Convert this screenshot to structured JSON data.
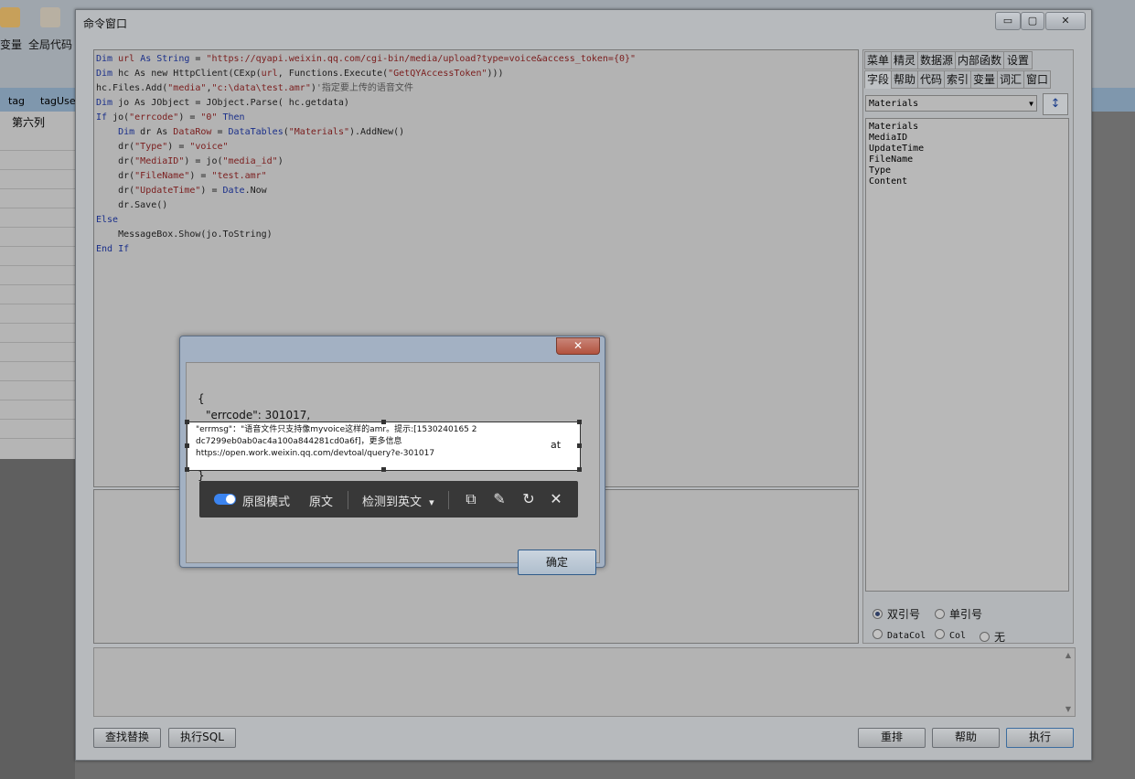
{
  "background": {
    "toolbar_labels": [
      "变量",
      "全局代码"
    ],
    "col_headers": [
      "tag",
      "tagUse"
    ],
    "column_label": "第六列"
  },
  "window": {
    "title": "命令窗口",
    "min_glyph": "▭",
    "max_glyph": "▢",
    "close_glyph": "✕"
  },
  "editor": {
    "code_lines": [
      [
        {
          "t": "Dim ",
          "c": "kw"
        },
        {
          "t": "url ",
          "c": "str"
        },
        {
          "t": "As String",
          "c": "kw"
        },
        {
          "t": " = ",
          "c": ""
        },
        {
          "t": "\"https://qyapi.weixin.qq.com/cgi-bin/media/upload?type=voice&access_token={0}\"",
          "c": "str"
        }
      ],
      [
        {
          "t": "Dim ",
          "c": "kw"
        },
        {
          "t": "hc As new HttpClient(CExp(",
          "c": ""
        },
        {
          "t": "url",
          "c": "str"
        },
        {
          "t": ", Functions.Execute(",
          "c": ""
        },
        {
          "t": "\"GetQYAccessToken\"",
          "c": "str"
        },
        {
          "t": ")))",
          "c": ""
        }
      ],
      [
        {
          "t": "hc.Files.Add(",
          "c": ""
        },
        {
          "t": "\"media\"",
          "c": "str"
        },
        {
          "t": ",",
          "c": ""
        },
        {
          "t": "\"c:\\data\\test.amr\"",
          "c": "str"
        },
        {
          "t": ")",
          "c": ""
        },
        {
          "t": "'指定要上传的语音文件",
          "c": "cm"
        }
      ],
      [
        {
          "t": "Dim ",
          "c": "kw"
        },
        {
          "t": "jo As JObject = JObject.Parse( hc.getdata)",
          "c": ""
        }
      ],
      [
        {
          "t": "If ",
          "c": "kw"
        },
        {
          "t": "jo(",
          "c": ""
        },
        {
          "t": "\"errcode\"",
          "c": "str"
        },
        {
          "t": ") = ",
          "c": ""
        },
        {
          "t": "\"0\"",
          "c": "str"
        },
        {
          "t": " Then",
          "c": "kw"
        }
      ],
      [
        {
          "t": "    Dim ",
          "c": "kw"
        },
        {
          "t": "dr As ",
          "c": ""
        },
        {
          "t": "DataRow",
          "c": "str"
        },
        {
          "t": " = ",
          "c": ""
        },
        {
          "t": "DataTables",
          "c": "kw"
        },
        {
          "t": "(",
          "c": ""
        },
        {
          "t": "\"Materials\"",
          "c": "str"
        },
        {
          "t": ").AddNew()",
          "c": ""
        }
      ],
      [
        {
          "t": "    dr(",
          "c": ""
        },
        {
          "t": "\"Type\"",
          "c": "str"
        },
        {
          "t": ") = ",
          "c": ""
        },
        {
          "t": "\"voice\"",
          "c": "str"
        }
      ],
      [
        {
          "t": "    dr(",
          "c": ""
        },
        {
          "t": "\"MediaID\"",
          "c": "str"
        },
        {
          "t": ") = jo(",
          "c": ""
        },
        {
          "t": "\"media_id\"",
          "c": "str"
        },
        {
          "t": ")",
          "c": ""
        }
      ],
      [
        {
          "t": "    dr(",
          "c": ""
        },
        {
          "t": "\"FileName\"",
          "c": "str"
        },
        {
          "t": ") = ",
          "c": ""
        },
        {
          "t": "\"test.amr\"",
          "c": "str"
        }
      ],
      [
        {
          "t": "    dr(",
          "c": ""
        },
        {
          "t": "\"UpdateTime\"",
          "c": "str"
        },
        {
          "t": ") = ",
          "c": ""
        },
        {
          "t": "Date",
          "c": "kw"
        },
        {
          "t": ".Now",
          "c": ""
        }
      ],
      [
        {
          "t": "    dr.Save()",
          "c": ""
        }
      ],
      [
        {
          "t": "Else",
          "c": "kw"
        }
      ],
      [
        {
          "t": "    MessageBox.Show(jo.ToString)",
          "c": ""
        }
      ],
      [
        {
          "t": "End If",
          "c": "kw"
        }
      ]
    ]
  },
  "right_panel": {
    "tabs_row1": [
      "菜单",
      "精灵",
      "数据源",
      "内部函数",
      "设置"
    ],
    "tabs_row2": [
      "字段",
      "帮助",
      "代码",
      "索引",
      "变量",
      "词汇",
      "窗口"
    ],
    "active_tab": "字段",
    "selected_table": "Materials",
    "sort_icon": "↕",
    "fields": [
      "Materials",
      "MediaID",
      "UpdateTime",
      "FileName",
      "Type",
      "Content"
    ],
    "quote_options": [
      "双引号",
      "单引号"
    ],
    "quote_selected": "双引号",
    "ref_options": [
      "DataCol",
      "Col",
      "无"
    ]
  },
  "buttons": {
    "find_replace": "查找替换",
    "exec_sql": "执行SQL",
    "rearrange": "重排",
    "help": "帮助",
    "execute": "执行"
  },
  "msgbox": {
    "close_glyph": "✕",
    "open_brace": "{",
    "errcode_line": "\"errcode\": 301017,",
    "close_brace": "}",
    "ok": "确定"
  },
  "translation": {
    "line1": "\"errmsg\"：\"语音文件只支持像myvoice这样的amr。提示:[1530240165 2",
    "line2": "dc7299eb0ab0ac4a100a844281cd0a6f]，更多信息",
    "line3": "https://open.work.weixin.qq.com/devtoal/query?e-301017",
    "suffix": "at",
    "mode_label": "原图模式",
    "original_label": "原文",
    "detect_label": "检测到英文",
    "detect_arrow": "▾",
    "copy_icon": "⧉",
    "edit_icon": "✎",
    "retry_icon": "↻",
    "close_icon": "✕"
  }
}
